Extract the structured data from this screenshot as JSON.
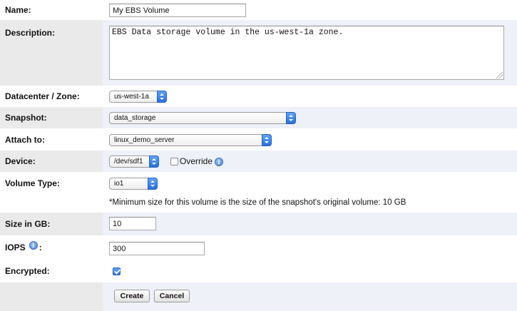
{
  "form": {
    "name": {
      "label": "Name:",
      "value": "My EBS Volume"
    },
    "description": {
      "label": "Description:",
      "value": "EBS Data storage volume in the us-west-1a zone."
    },
    "datacenter": {
      "label": "Datacenter / Zone:",
      "selected": "us-west-1a"
    },
    "snapshot": {
      "label": "Snapshot:",
      "selected": "data_storage"
    },
    "attach_to": {
      "label": "Attach to:",
      "selected": "linux_demo_server"
    },
    "device": {
      "label": "Device:",
      "selected": "/dev/sdf1",
      "override_label": "Override",
      "override_checked": false
    },
    "volume_type": {
      "label": "Volume Type:",
      "selected": "io1"
    },
    "min_size_note": "*Minimum size for this volume is the size of the snapshot's original volume: 10 GB",
    "size": {
      "label": "Size in GB:",
      "value": "10"
    },
    "iops": {
      "label": "IOPS",
      "colon": ":",
      "value": "300"
    },
    "encrypted": {
      "label": "Encrypted:",
      "checked": true
    },
    "buttons": {
      "create": "Create",
      "cancel": "Cancel"
    }
  },
  "icons": {
    "info": "info-icon",
    "checkbox": "checkbox",
    "select_arrow": "chevron-updown-icon"
  },
  "colors": {
    "label_bg": "#eaeaea",
    "row_alt_bg": "#eef1f8",
    "accent": "#2a6fd8"
  }
}
